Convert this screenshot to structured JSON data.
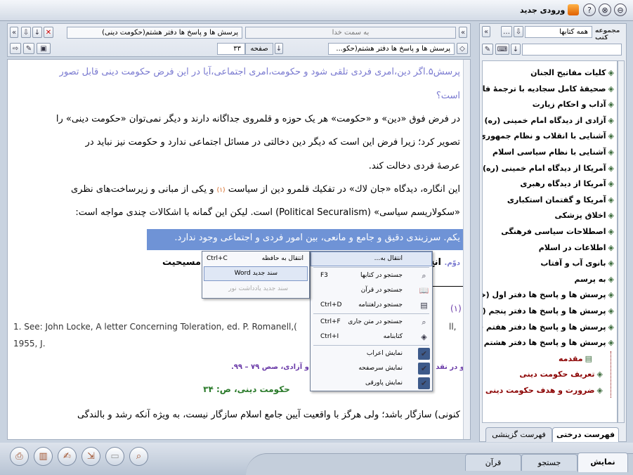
{
  "window": {
    "title": "ورودی جدید",
    "controls": [
      "⊗",
      "⊖",
      "?"
    ]
  },
  "left_toolbar": {
    "tab_title": "پرسش ها و پاسخ ها دفتر هشتم(حکومت دینی)",
    "nav_field": "به سمت خدا",
    "page_label": "صفحه",
    "page_value": "۳۳",
    "book_select": "پرسش ها و پاسخ ها دفتر هشتم(حکو..."
  },
  "document": {
    "question": "پرسش۵.اگر دین،امری فردی تلقی شود و حکومت،امری اجتماعی،آیا در این فرض حکومت دینی قابل تصور",
    "question_cont": "است؟",
    "p1a": "در فرض فوق «دین» و «حکومت» هر یک حوزه و قلمروی جداگانه دارند و دیگر نمی‌توان «حکومت دینی» را",
    "p1b": "تصویر کرد؛ زیرا فرض این است که دیگر دین دخالتی در مسائل اجتماعی ندارد و حکومت نیز نباید در",
    "p1c": "عرصهٔ فردی دخالت کند.",
    "p2a_main": "این انگاره، دیدگاه «جان لاك» در تفکیك قلمرو دین از سیاست",
    "p2a_ref": "(۱)",
    "p2a_end": "و یکی از مبانی و زیرساخت‌های نظری",
    "p2b": "«سکولاریسم سیاسی» (Political Securalism) است. لیکن این گمانه با اشکالات چندی مواجه است:",
    "p3": "یکم. سرزبندی دقیق و جامع و مانعی، بین امور فردی و اجتماعی وجود ندارد.",
    "p4_prefix": "دوّم.",
    "p4_main": "انح",
    "p4_end": "ند مسیحیت",
    "footnote_num": "(۱)",
    "footnote_en1": "1. See: John Locke, A letter Concerning Toleration, ed. P. Romanell,(",
    "footnote_en1_end": "ll,",
    "footnote_en2": "1955, J.",
    "footnote_fa_start": "و در نقد ",
    "footnote_fa_end": "و آزادی، صص ۷۹ – ۹۹.",
    "page_marker": "حکومت دینی، ص: ۳۴",
    "p5": "کنونی) سازگار باشد؛ ولی هرگز با واقعیت آیین جامع اسلام سازگار نیست، به ویژه آنکه رشد و بالندگی"
  },
  "context_menu": {
    "items": [
      {
        "label": "انتقال به...",
        "shortcut": "",
        "icon": ""
      },
      {
        "label": "جستجو در کتابها",
        "shortcut": "F3",
        "icon": "search-icon"
      },
      {
        "label": "جستجو در قرآن",
        "shortcut": "",
        "icon": "book-icon"
      },
      {
        "label": "جستجو درلغتنامه",
        "shortcut": "Ctrl+D",
        "icon": "dictionary-icon"
      },
      {
        "label": "جستجو در متن جاری",
        "shortcut": "Ctrl+F",
        "icon": "search-icon"
      },
      {
        "label": "کتابنامه",
        "shortcut": "Ctrl+I",
        "icon": "bookmark-icon"
      },
      {
        "label": "نمایش اعراب",
        "shortcut": "",
        "icon": "check-icon"
      },
      {
        "label": "نمایش سرصفحه",
        "shortcut": "",
        "icon": "check-icon"
      },
      {
        "label": "نمایش پاورقی",
        "shortcut": "",
        "icon": "check-icon"
      }
    ]
  },
  "submenu": {
    "items": [
      {
        "label": "انتقال به حافظه",
        "shortcut": "Ctrl+C"
      },
      {
        "label": "سند جدید Word",
        "shortcut": ""
      },
      {
        "label": "سند جدید یادداشت نور",
        "shortcut": ""
      }
    ]
  },
  "right_panel": {
    "collection_label": "مجموعه کتب",
    "collection_value": "همه کتابها",
    "tree": [
      "کلیات مفاتیح الجنان",
      "صحیفهٔ کامل سجادیه با ترجمهٔ فارسی",
      "آداب و احکام زیارت",
      "آزادی از دیدگاه امام خمینی (ره)",
      "آشنایی با انقلاب و نظام جمهوری اسلامی",
      "آشنایی با نظام سیاسی اسلام",
      "آمریکا از دیدگاه امام خمینی (ره)",
      "آمریکا از دیدگاه رهبری",
      "آمریکا و گفتمان استکباری",
      "اخلاق پزشکی",
      "اصطلاحات سیاسی فرهنگی",
      "اطلاعات در اسلام",
      "بانوی آب و آفتاب",
      "به پرسم",
      "پرسش ها و پاسخ ها دفتر اول (خداشناسی)",
      "پرسش ها و پاسخ ها دفتر پنجم (قرآن)",
      "پرسش ها و پاسخ ها دفتر هفتم (پرسش)",
      "پرسش ها و پاسخ ها دفتر هشتم (حکومت دینی)"
    ],
    "subtree": [
      "مقدمه",
      "تعریف حکومت دینی",
      "ضرورت و هدف حکومت دینی"
    ],
    "tabs": [
      "فهرست درختی",
      "فهرست گزینشی"
    ]
  },
  "bottom_tabs": [
    "نمایش",
    "جستجو",
    "قرآن"
  ]
}
